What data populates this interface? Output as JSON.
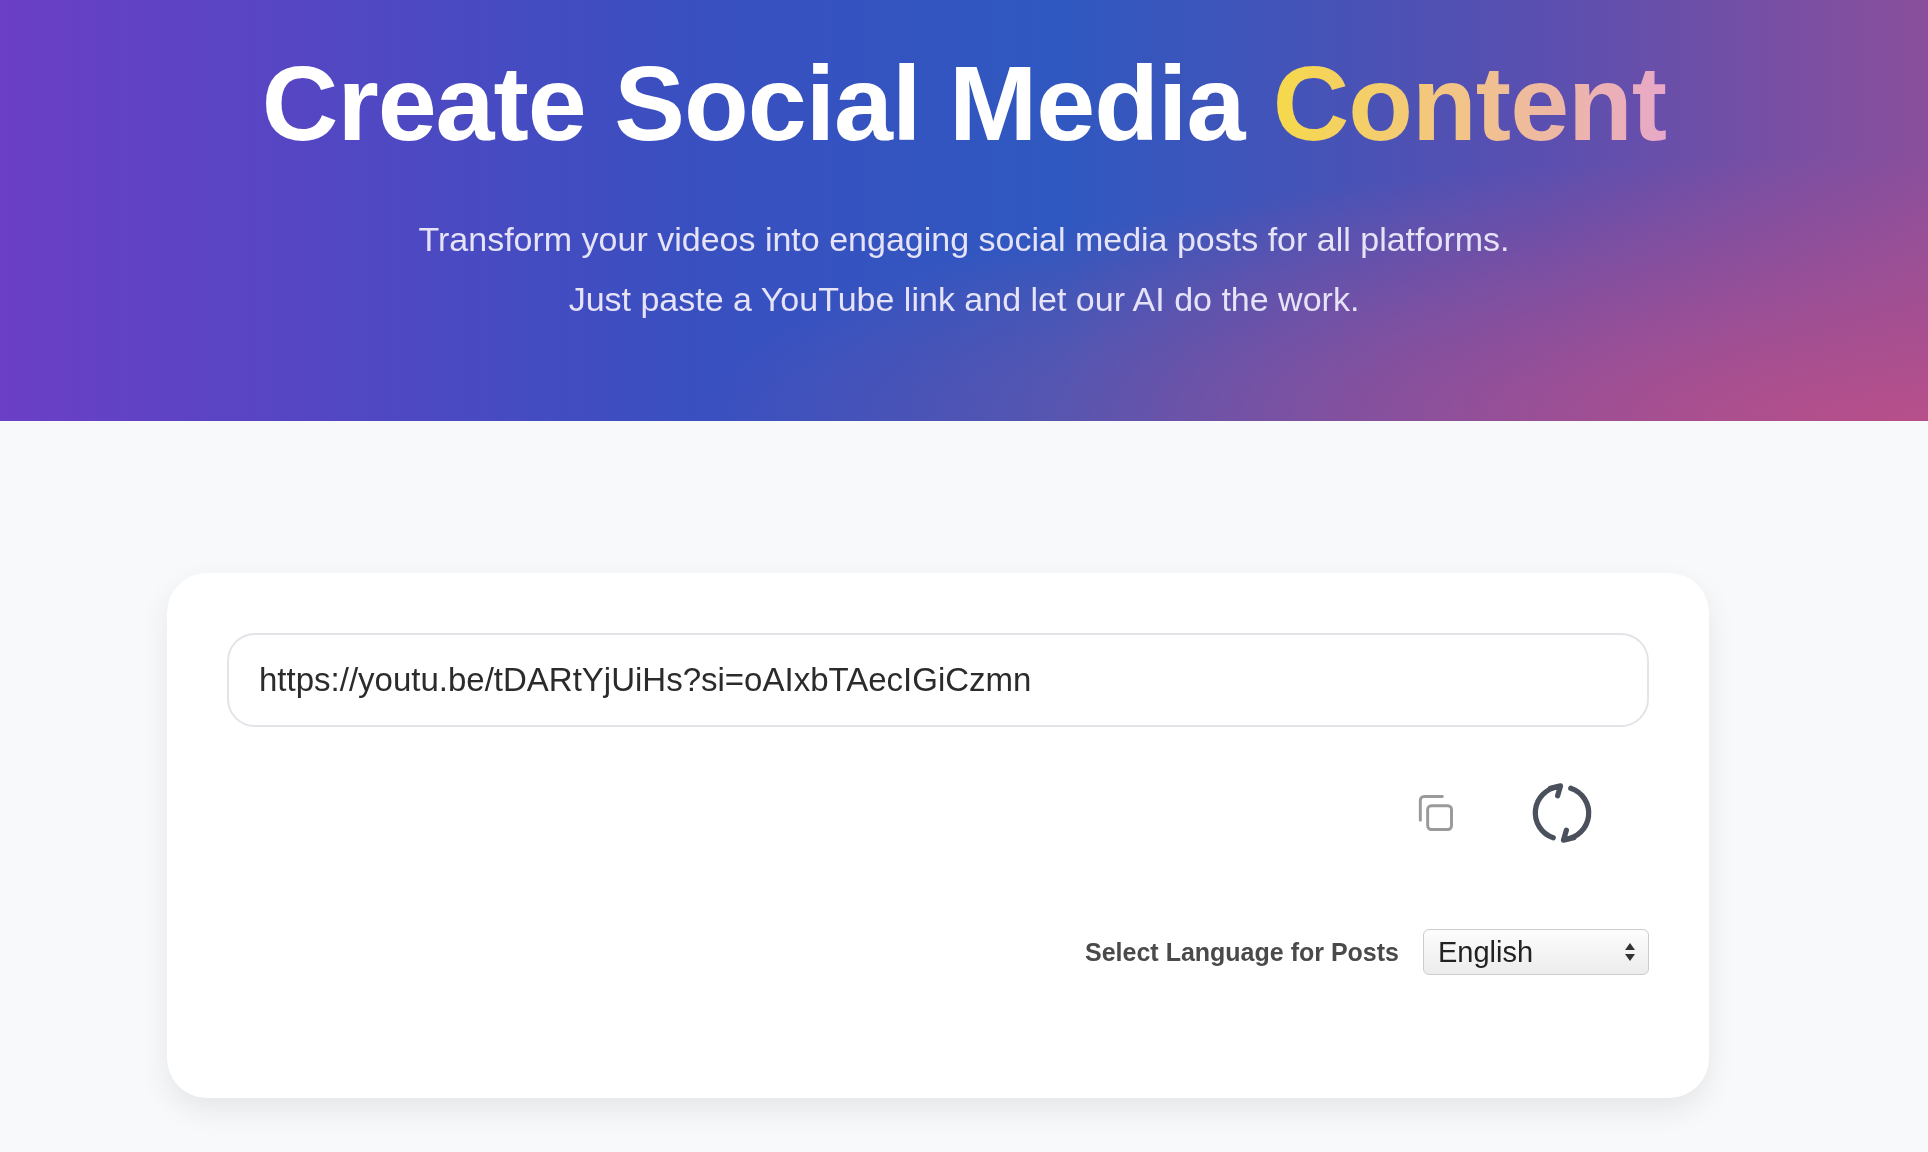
{
  "hero": {
    "title": "Create Social Media",
    "title_highlight": "Content",
    "subtitle": "Transform your videos into engaging social media posts for all platforms. Just paste a YouTube link and let our AI do the work."
  },
  "card": {
    "url_field": {
      "value": "https://youtu.be/tDARtYjUiHs?si=oAIxbTAecIGiCzmn"
    },
    "language": {
      "label": "Select Language for Posts",
      "value": "English"
    }
  }
}
